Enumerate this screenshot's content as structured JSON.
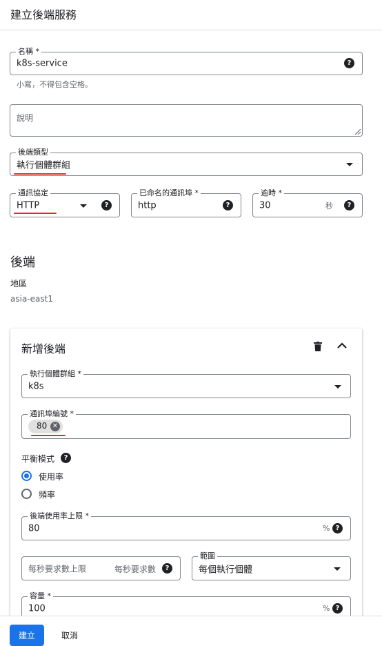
{
  "header": {
    "title": "建立後端服務"
  },
  "form": {
    "name": {
      "label": "名稱 *",
      "value": "k8s-service",
      "hint": "小寫，不得包含空格。"
    },
    "description": {
      "placeholder": "說明"
    },
    "backend_type": {
      "label": "後端類型",
      "value": "執行個體群組"
    },
    "protocol": {
      "label": "通訊協定",
      "value": "HTTP"
    },
    "named_port": {
      "label": "已命名的通訊埠 *",
      "value": "http"
    },
    "timeout": {
      "label": "逾時 *",
      "value": "30",
      "unit": "秒"
    }
  },
  "backends": {
    "heading": "後端",
    "region_label": "地區",
    "region_value": "asia-east1",
    "new_backend": {
      "title": "新增後端",
      "instance_group": {
        "label": "執行個體群組 *",
        "value": "k8s"
      },
      "port_numbers": {
        "label": "通訊埠編號 *",
        "chips": [
          "80"
        ]
      },
      "balancing_mode": {
        "label": "平衡模式",
        "options": [
          {
            "label": "使用率",
            "selected": true
          },
          {
            "label": "頻率",
            "selected": false
          }
        ]
      },
      "max_utilization": {
        "label": "後端使用率上限 *",
        "value": "80",
        "unit": "%"
      },
      "max_rps": {
        "placeholder": "每秒要求數上限",
        "unit": "每秒要求數"
      },
      "scope": {
        "label": "範圍",
        "value": "每個執行個體"
      },
      "capacity": {
        "label": "容量 *",
        "value": "100",
        "unit": "%"
      }
    }
  },
  "footer": {
    "create_label": "建立",
    "cancel_label": "取消"
  },
  "colors": {
    "primary": "#1a73e8",
    "annotation": "#d93025"
  },
  "icons": [
    "help-icon",
    "caret-down-icon",
    "trash-icon",
    "chevron-up-icon",
    "chip-remove-icon"
  ]
}
